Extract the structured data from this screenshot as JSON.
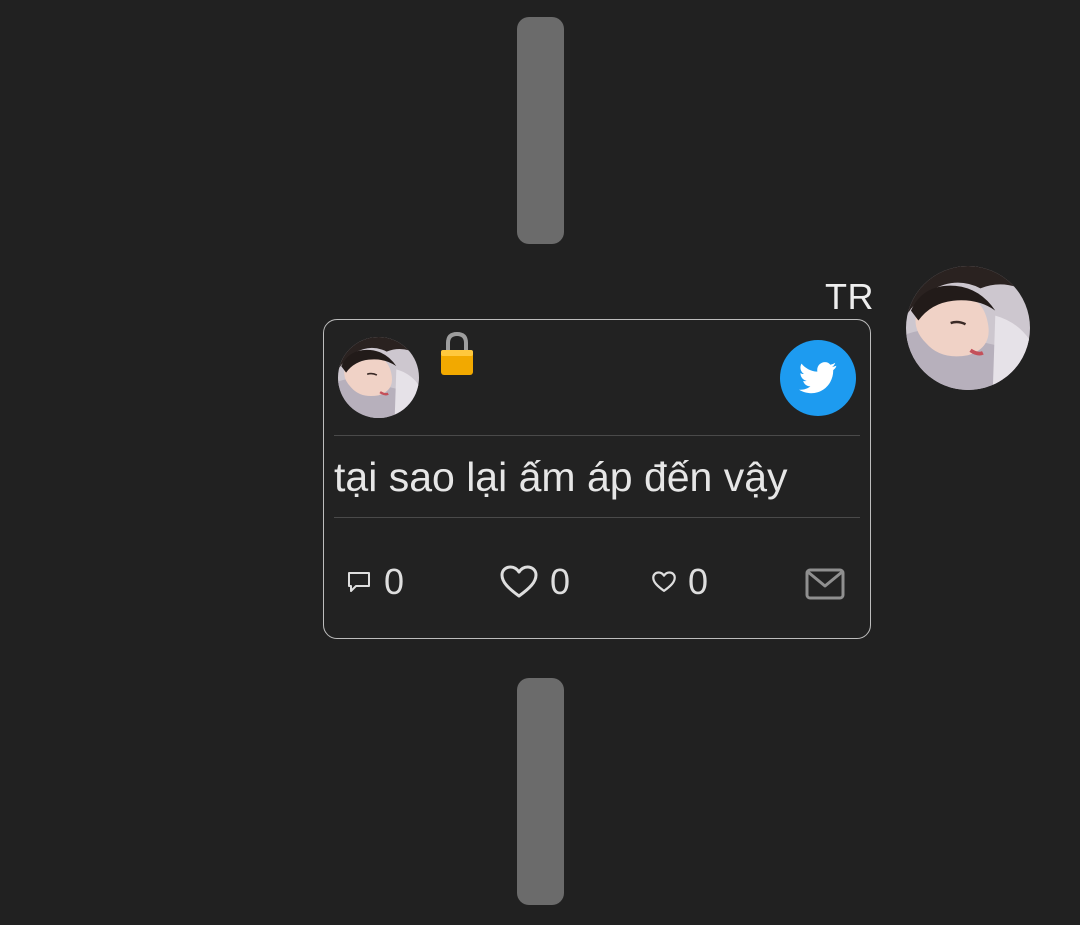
{
  "sender": {
    "name": "TR",
    "avatar": "profile-photo"
  },
  "card": {
    "avatar": "profile-photo",
    "lock_icon": "lock-icon",
    "share_icon": "twitter-bird-icon",
    "message": "tại sao lại ấm áp đến vậy",
    "actions": {
      "comment": {
        "icon": "comment-icon",
        "count": "0"
      },
      "like": {
        "icon": "heart-icon",
        "count": "0"
      },
      "small_like": {
        "icon": "small-heart-icon",
        "count": "0"
      },
      "mail": {
        "icon": "mail-icon"
      }
    }
  },
  "colors": {
    "background": "#212121",
    "divider_bar": "#6b6b6b",
    "card_border": "#bdbdbd",
    "twitter_blue": "#1d9bf0",
    "text": "#e6e6e6",
    "lock": "#f2a900"
  }
}
